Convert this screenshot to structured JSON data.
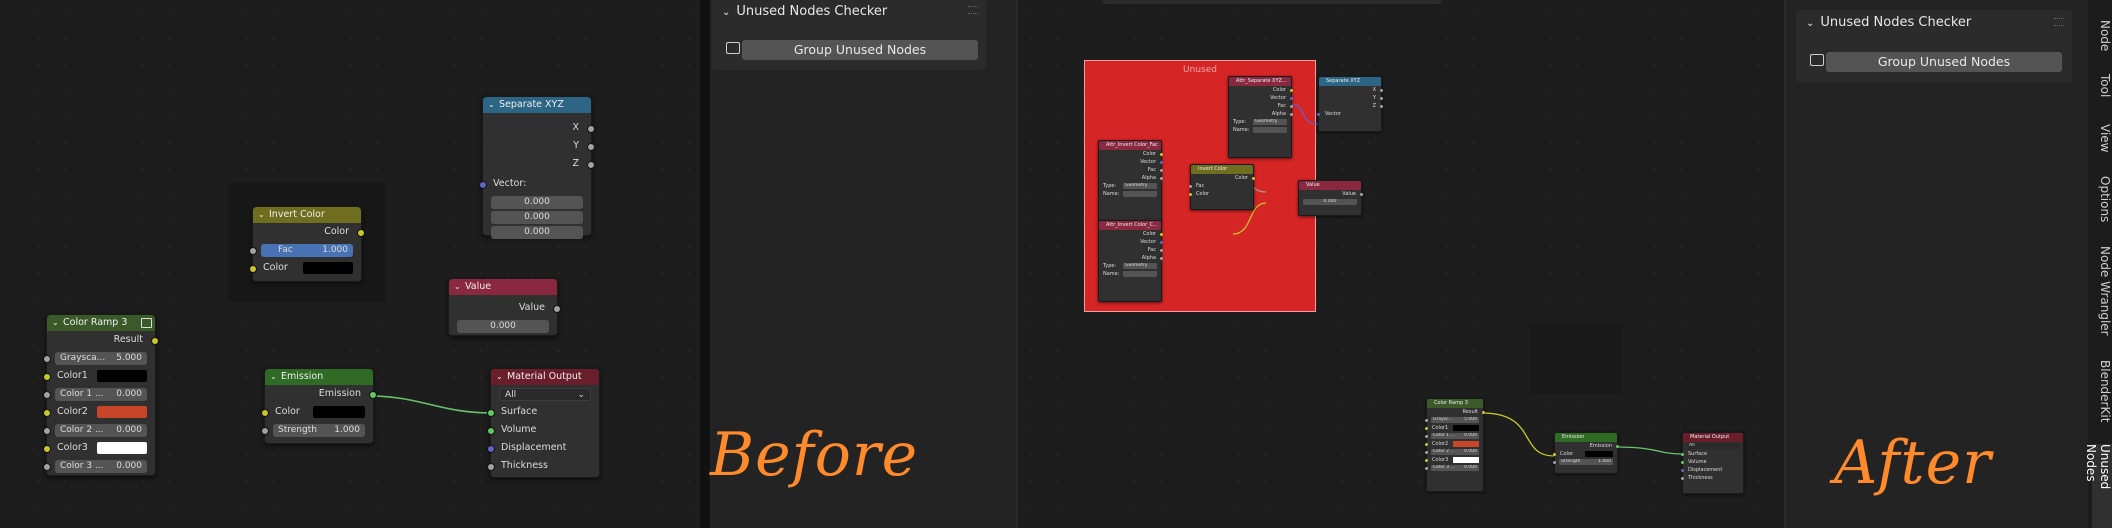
{
  "colors": {
    "bg": "#1d1d1d",
    "socket_yellow": "#c7c729",
    "socket_grey": "#a1a1a1",
    "socket_purple": "#6363c7",
    "socket_green": "#63c763",
    "link_green": "#6ac36a",
    "link_yellow": "#cccc30",
    "unused_frame": "#d52525",
    "annotation_orange": "#ff8a2c",
    "header_colorramp": "#3b5a2a",
    "header_invert": "#6f6e1e",
    "header_separate": "#2d6684",
    "header_value": "#8a2840",
    "header_emission": "#2f6b25",
    "header_output": "#6a1e2c"
  },
  "before": {
    "separate_xyz": {
      "title": "Separate XYZ",
      "out_x": "X",
      "out_y": "Y",
      "out_z": "Z",
      "in_label": "Vector:",
      "v1": "0.000",
      "v2": "0.000",
      "v3": "0.000"
    },
    "invert_color": {
      "title": "Invert Color",
      "out_color": "Color",
      "fac_label": "Fac",
      "fac_value": "1.000",
      "color_label": "Color"
    },
    "value": {
      "title": "Value",
      "out_label": "Value",
      "value": "0.000"
    },
    "color_ramp": {
      "title": "Color Ramp 3",
      "out_result": "Result",
      "grayscale_label": "Graysca...",
      "grayscale_value": "5.000",
      "color1": "Color1",
      "color1_pos_label": "Color 1 ...",
      "color1_pos": "0.000",
      "color2": "Color2",
      "color2_pos_label": "Color 2 ...",
      "color2_pos": "0.000",
      "color3": "Color3",
      "color3_pos_label": "Color 3 ...",
      "color3_pos": "0.000"
    },
    "emission": {
      "title": "Emission",
      "out_label": "Emission",
      "color_label": "Color",
      "strength_label": "Strength",
      "strength_value": "1.000"
    },
    "material_output": {
      "title": "Material Output",
      "target": "All",
      "surface": "Surface",
      "volume": "Volume",
      "displacement": "Displacement",
      "thickness": "Thickness"
    },
    "panel": {
      "title": "Unused Nodes Checker",
      "button": "Group Unused Nodes"
    },
    "annotation": "Before"
  },
  "after": {
    "frame_label": "Unused",
    "attr1": {
      "title": "Attr_Separate XYZ...",
      "outs": [
        "Color",
        "Vector",
        "Fac",
        "Alpha"
      ],
      "type_label": "Type:",
      "type_value": "Geometry",
      "name_label": "Name:"
    },
    "sepxyz": {
      "title": "Separate XYZ",
      "outs": [
        "X",
        "Y",
        "Z"
      ],
      "in_label": "Vector"
    },
    "attr2": {
      "title": "Attr_Invert Color_Fac",
      "outs": [
        "Color",
        "Vector",
        "Fac",
        "Alpha"
      ],
      "type_label": "Type:",
      "type_value": "Geometry",
      "name_label": "Name:"
    },
    "invert": {
      "title": "Invert Color",
      "out": "Color",
      "fac": "Fac",
      "color": "Color"
    },
    "value": {
      "title": "Value",
      "out": "Value",
      "value": "0.000"
    },
    "attr3": {
      "title": "Attr_Invert Color_C...",
      "outs": [
        "Color",
        "Vector",
        "Fac",
        "Alpha"
      ],
      "type_label": "Type:",
      "type_value": "Geometry",
      "name_label": "Name:"
    },
    "ramp": {
      "title": "Color Ramp 3",
      "out": "Result",
      "gray": "Graysc...",
      "gray_v": "5.000",
      "c1": "Color1",
      "c1p": "Color 1 ...",
      "c1v": "0.000",
      "c2": "Color2",
      "c2p": "Color 2 ...",
      "c2v": "0.000",
      "c3": "Color3",
      "c3p": "Color 3 ...",
      "c3v": "0.000"
    },
    "emission": {
      "title": "Emission",
      "out": "Emission",
      "color": "Color",
      "strength": "Strength",
      "strength_v": "1.000"
    },
    "output": {
      "title": "Material Output",
      "target": "All",
      "surface": "Surface",
      "volume": "Volume",
      "displacement": "Displacement",
      "thickness": "Thickness"
    },
    "panel": {
      "title": "Unused Nodes Checker",
      "button": "Group Unused Nodes"
    },
    "tabs": [
      "Node",
      "Tool",
      "View",
      "Options",
      "Node Wrangler",
      "BlenderKit",
      "Unused Nodes"
    ],
    "annotation": "After"
  }
}
